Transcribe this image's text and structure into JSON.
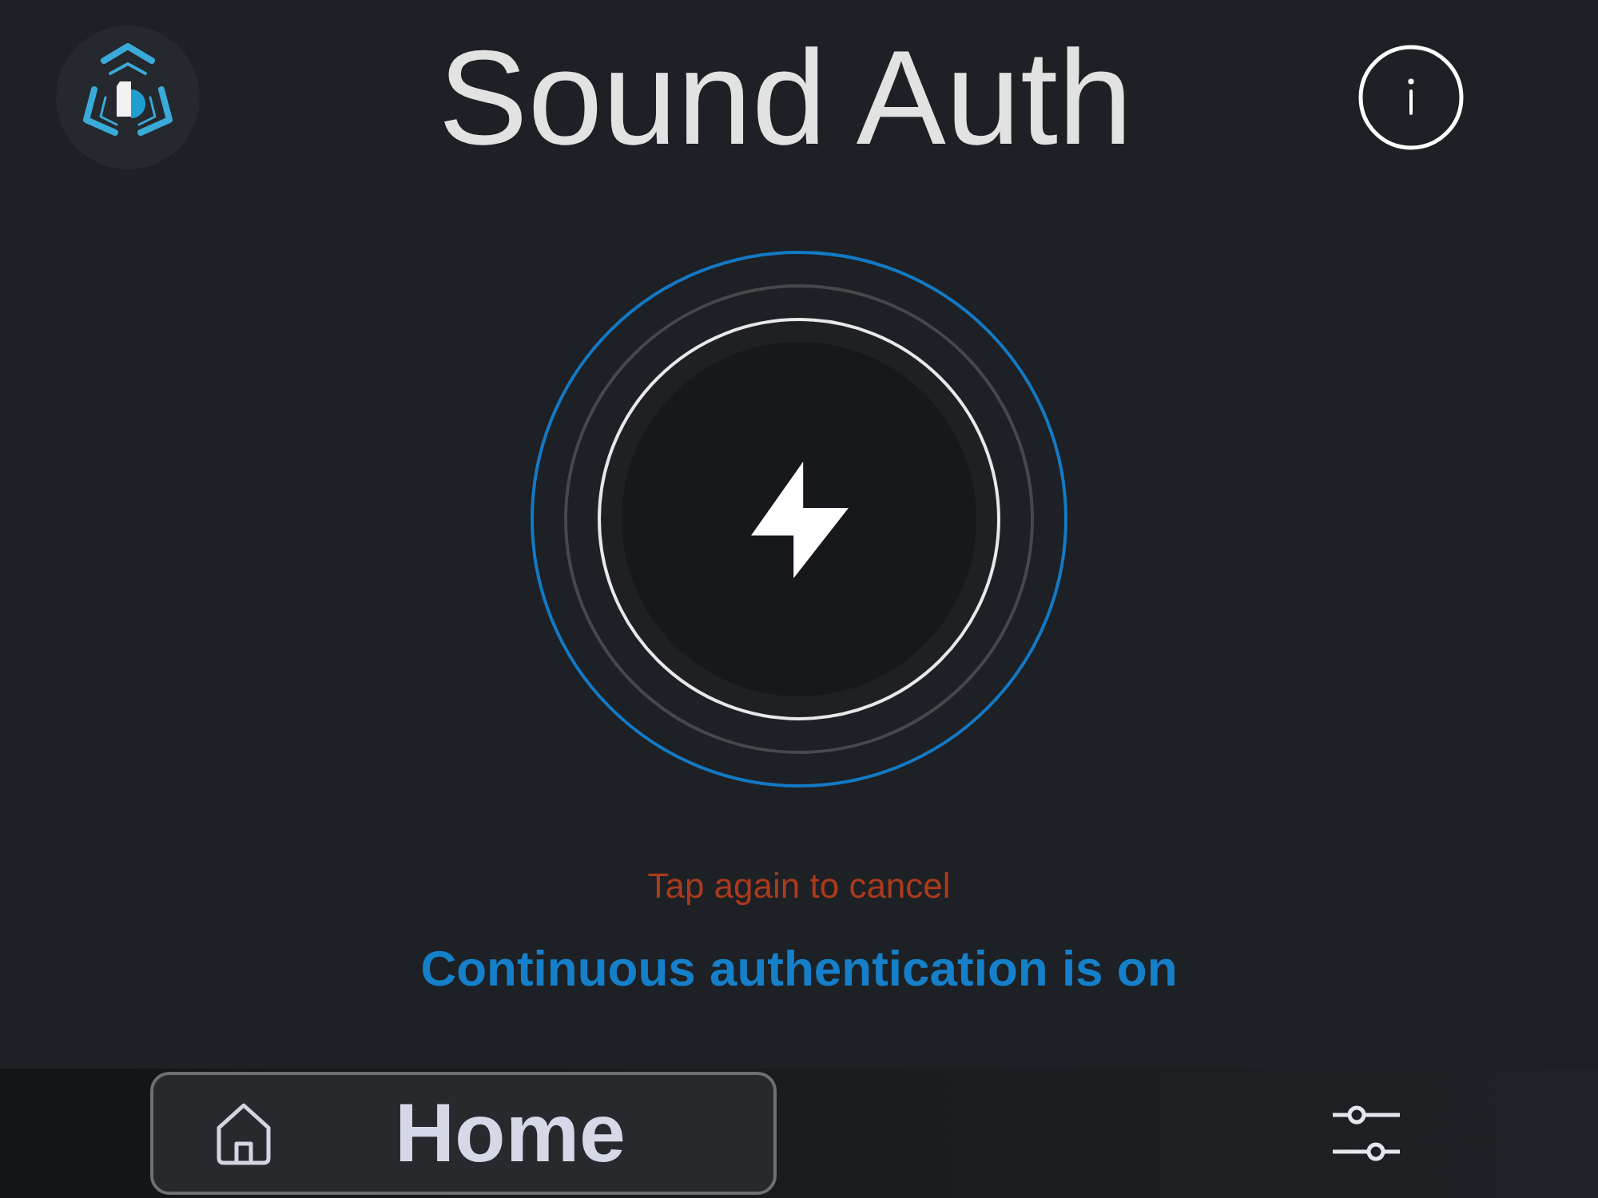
{
  "header": {
    "title": "Sound Auth"
  },
  "auth_button": {
    "active": true
  },
  "hint": "Tap again to cancel",
  "status": "Continuous authentication is on",
  "nav": {
    "items": [
      {
        "kind": "home",
        "label": "Home",
        "selected": true
      },
      {
        "kind": "settings",
        "selected": false
      }
    ]
  }
}
